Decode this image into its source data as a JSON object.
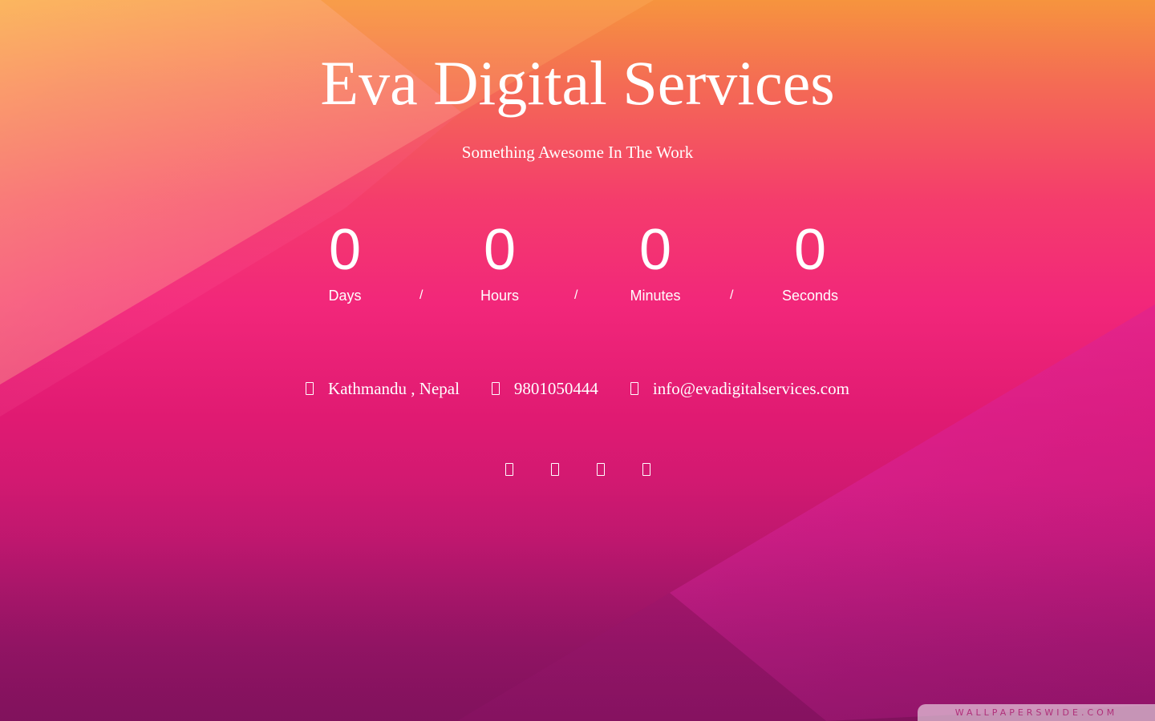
{
  "header": {
    "title": "Eva Digital Services",
    "subtitle": "Something Awesome In The Work"
  },
  "countdown": {
    "separator": "/",
    "units": [
      {
        "value": "0",
        "label": "Days"
      },
      {
        "value": "0",
        "label": "Hours"
      },
      {
        "value": "0",
        "label": "Minutes"
      },
      {
        "value": "0",
        "label": "Seconds"
      }
    ]
  },
  "contact": {
    "location": {
      "icon": "map-marker-icon",
      "text": "Kathmandu , Nepal"
    },
    "phone": {
      "icon": "phone-icon",
      "text": "9801050444"
    },
    "email": {
      "icon": "envelope-icon",
      "text": "info@evadigitalservices.com"
    }
  },
  "social": [
    {
      "icon": "facebook-icon"
    },
    {
      "icon": "twitter-icon"
    },
    {
      "icon": "instagram-icon"
    },
    {
      "icon": "linkedin-icon"
    }
  ],
  "watermark": "WALLPAPERSWIDE.COM",
  "colors": {
    "gradient_top": "#f6943e",
    "gradient_mid": "#f2277a",
    "gradient_bottom": "#8b135f",
    "text": "#ffffff"
  }
}
